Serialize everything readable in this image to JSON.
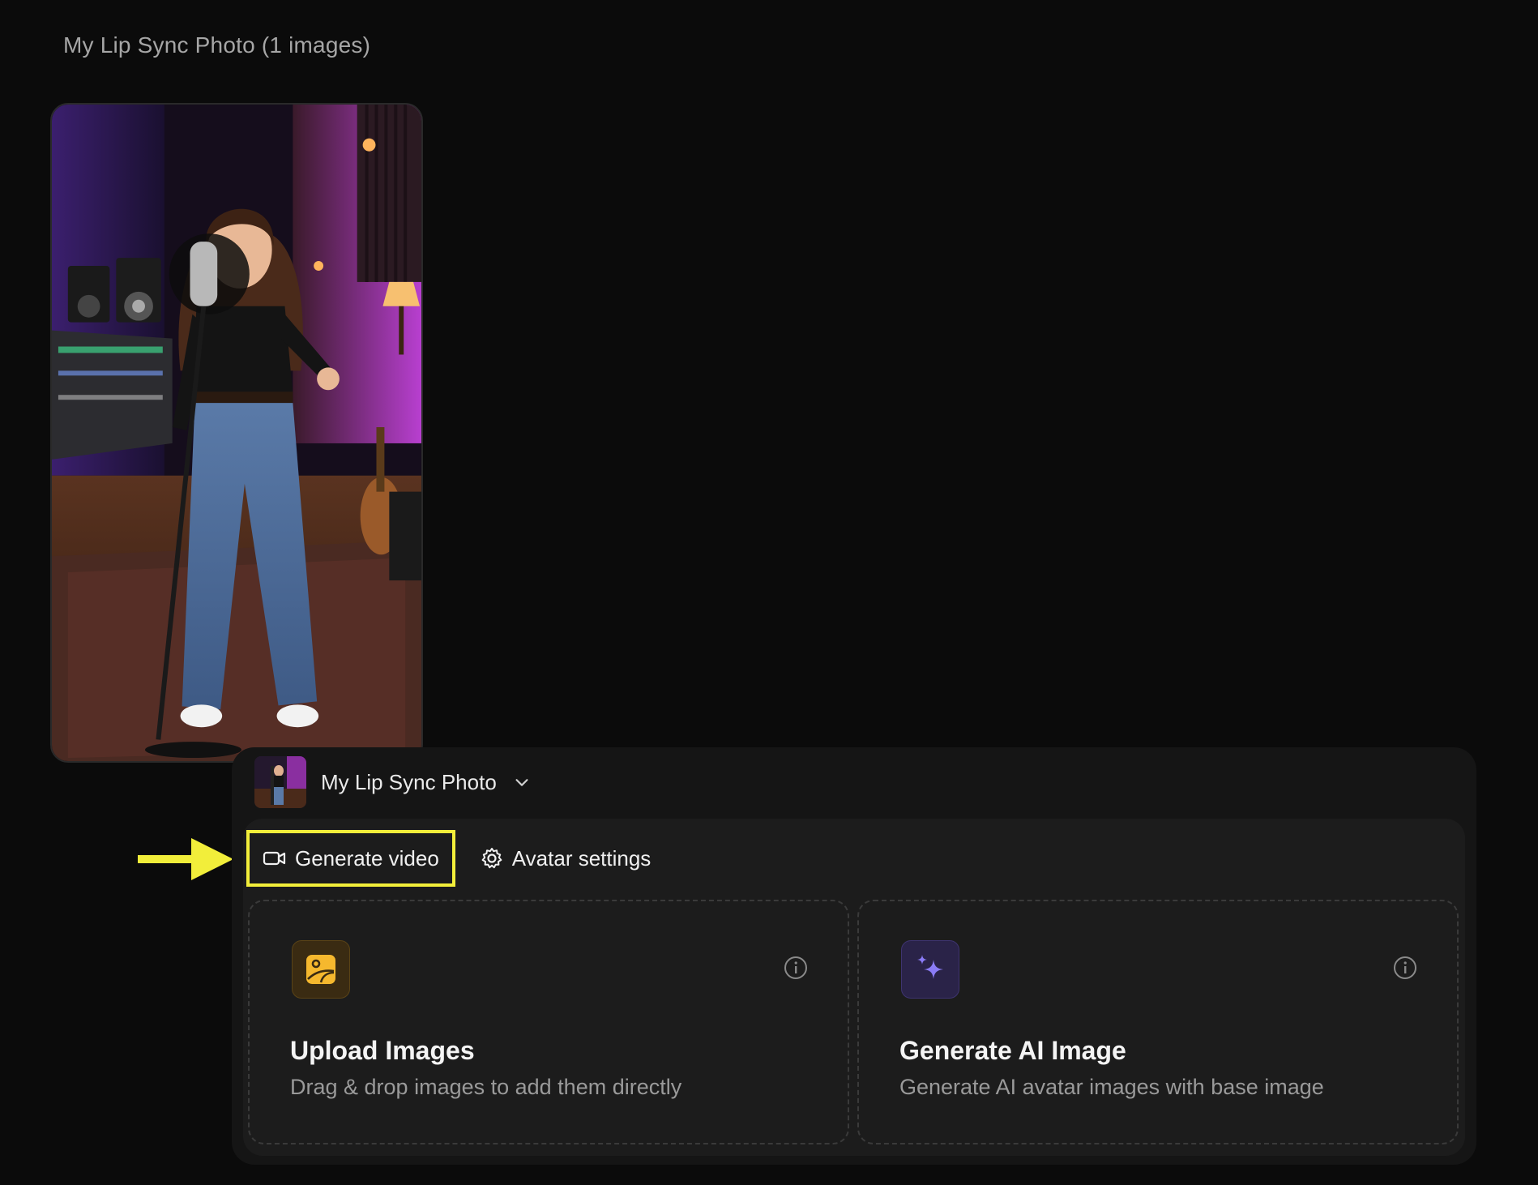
{
  "gallery": {
    "title": "My Lip Sync Photo (1 images)"
  },
  "photo": {
    "description_icon": "studio-singer-photo"
  },
  "avatar_selector": {
    "name": "My Lip Sync Photo",
    "icon": "chevron-down-icon"
  },
  "tabs": [
    {
      "label": "Generate video",
      "icon": "video-camera-icon",
      "active": true
    },
    {
      "label": "Avatar settings",
      "icon": "gear-icon",
      "active": false
    }
  ],
  "cards": [
    {
      "title": "Upload Images",
      "description": "Drag & drop images to add them directly",
      "icon": "image-upload-icon",
      "accent": "#f5b82e"
    },
    {
      "title": "Generate AI Image",
      "description": "Generate AI avatar images with base image",
      "icon": "sparkles-icon",
      "accent": "#8b7cf6"
    }
  ],
  "annotation": {
    "arrow_color": "#f2ee3a"
  }
}
